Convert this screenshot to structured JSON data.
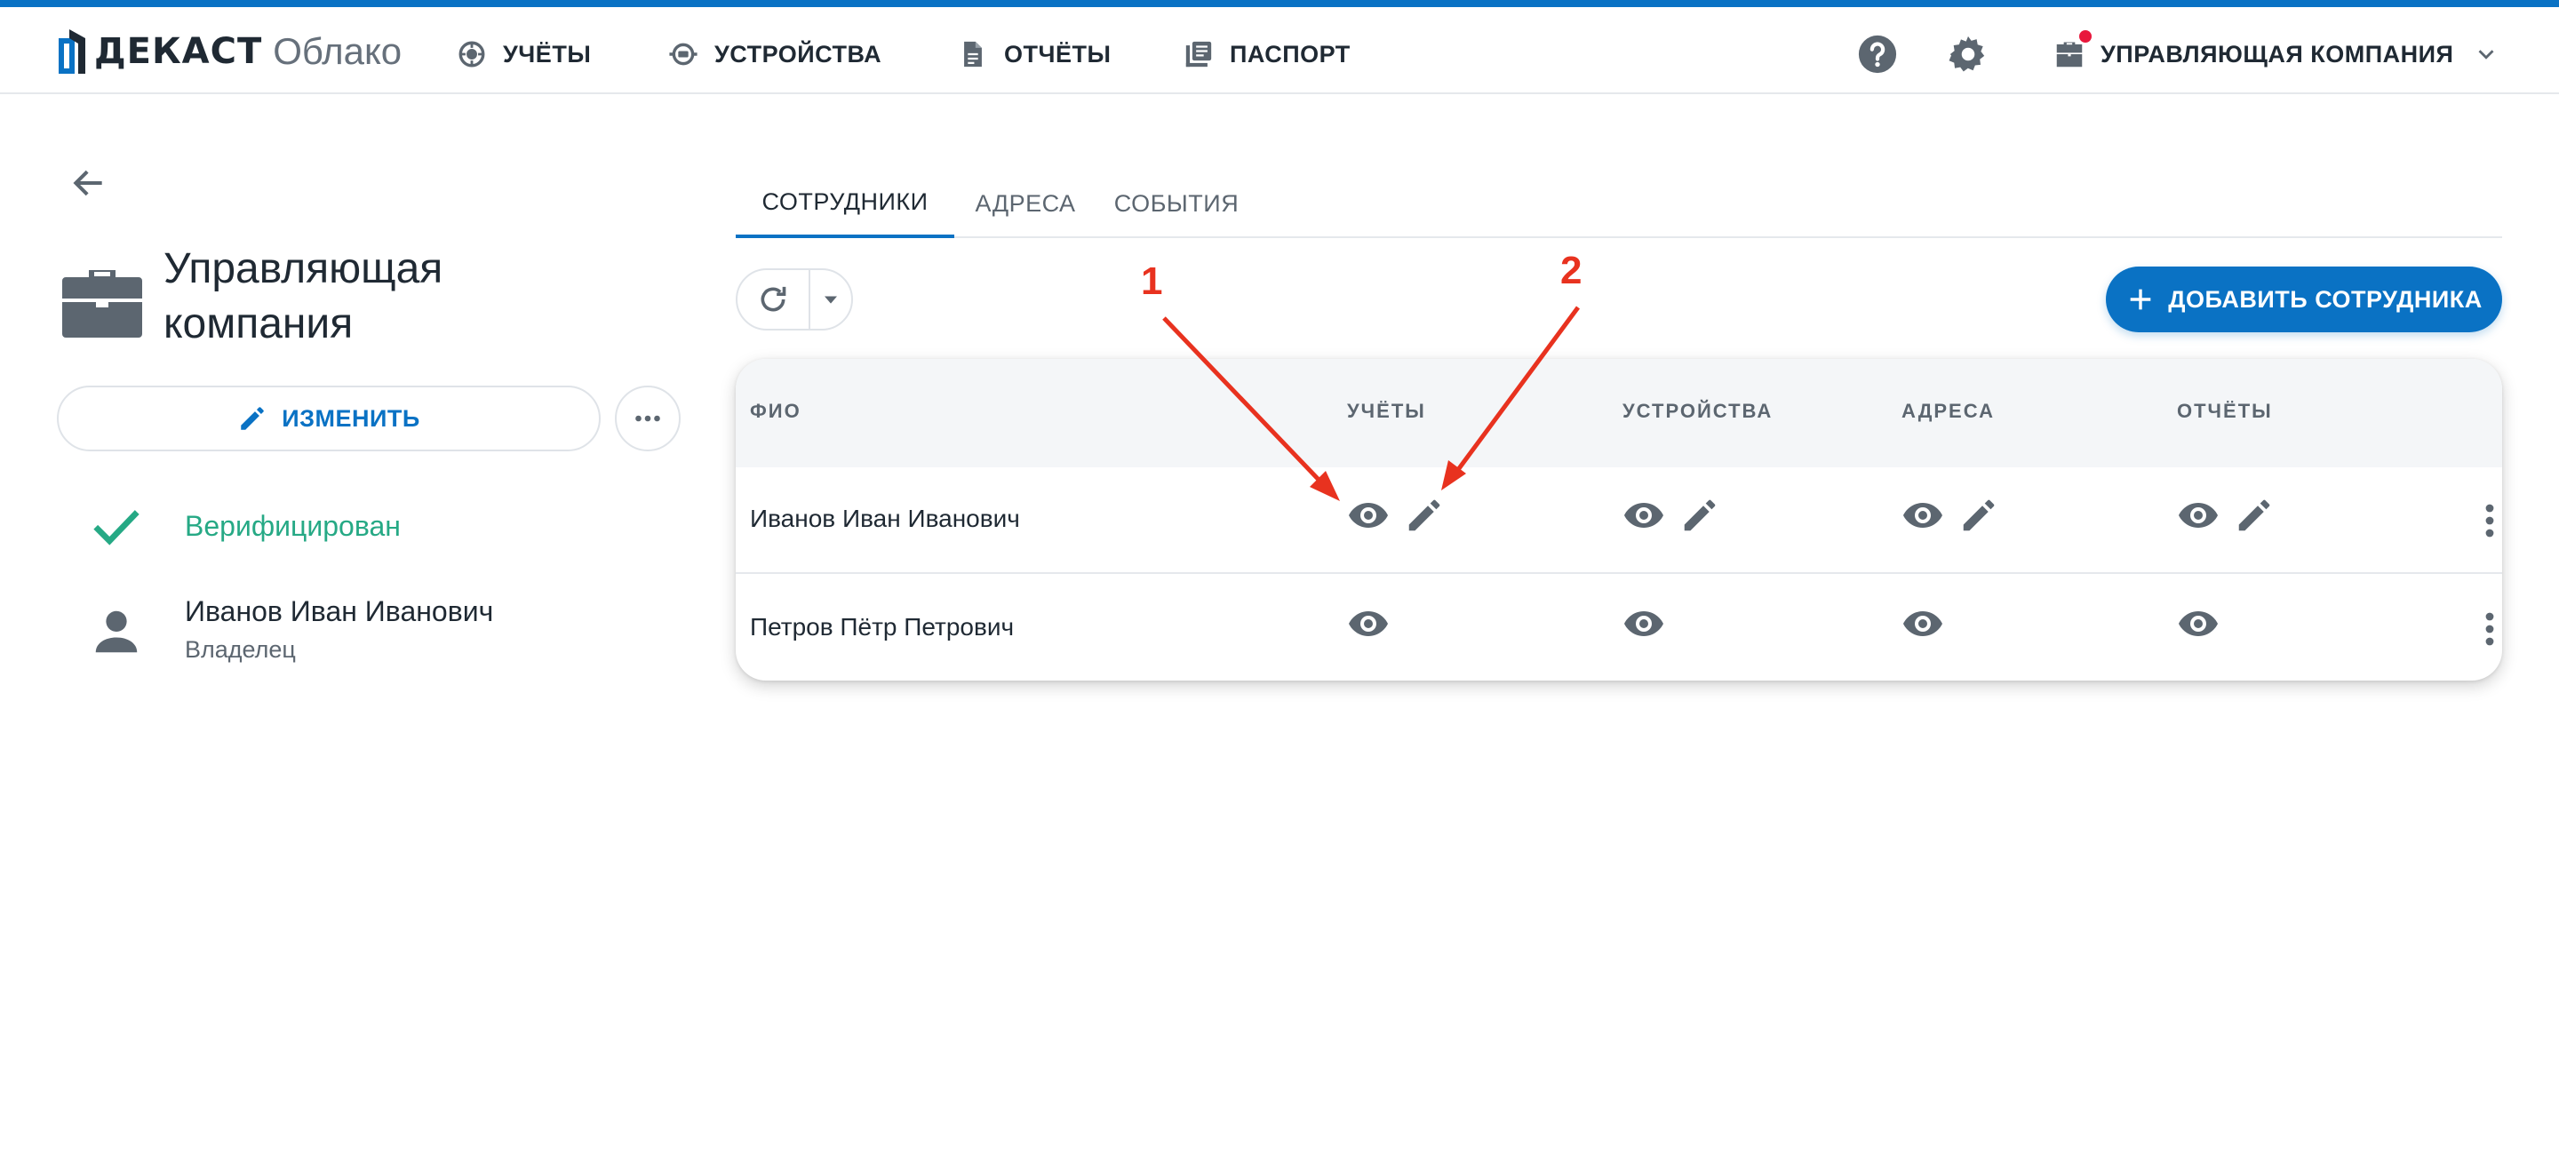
{
  "header": {
    "brand": "ДЕКАСТ",
    "product": "Облако",
    "nav": [
      {
        "label": "УЧЁТЫ",
        "icon": "meter-icon"
      },
      {
        "label": "УСТРОЙСТВА",
        "icon": "device-icon"
      },
      {
        "label": "ОТЧЁТЫ",
        "icon": "report-icon"
      },
      {
        "label": "ПАСПОРТ",
        "icon": "passport-icon"
      }
    ],
    "org": "УПРАВЛЯЮЩАЯ КОМПАНИЯ",
    "icons": [
      "help-icon",
      "gear-icon",
      "briefcase-icon",
      "chevron-down-icon"
    ]
  },
  "company": {
    "title_line1": "Управляющая",
    "title_line2": "компания",
    "edit_label": "ИЗМЕНИТЬ",
    "status": "Верифицирован",
    "owner_name": "Иванов Иван Иванович",
    "owner_role": "Владелец"
  },
  "tabs": [
    {
      "label": "СОТРУДНИКИ",
      "active": true
    },
    {
      "label": "АДРЕСА",
      "active": false
    },
    {
      "label": "СОБЫТИЯ",
      "active": false
    }
  ],
  "toolbar": {
    "add_label": "ДОБАВИТЬ СОТРУДНИКА"
  },
  "table": {
    "columns": [
      "ФИО",
      "УЧЁТЫ",
      "УСТРОЙСТВА",
      "АДРЕСА",
      "ОТЧЁТЫ"
    ],
    "rows": [
      {
        "name": "Иванов Иван Иванович",
        "view": [
          true,
          true,
          true,
          true
        ],
        "edit": [
          true,
          true,
          true,
          true
        ]
      },
      {
        "name": "Петров Пётр Петрович",
        "view": [
          true,
          true,
          true,
          true
        ],
        "edit": [
          false,
          false,
          false,
          false
        ]
      }
    ]
  },
  "annotations": [
    {
      "label": "1"
    },
    {
      "label": "2"
    }
  ],
  "colors": {
    "accent": "#0a72c4",
    "verified": "#26a985",
    "annotation": "#e8321f",
    "notification": "#e8173c"
  }
}
